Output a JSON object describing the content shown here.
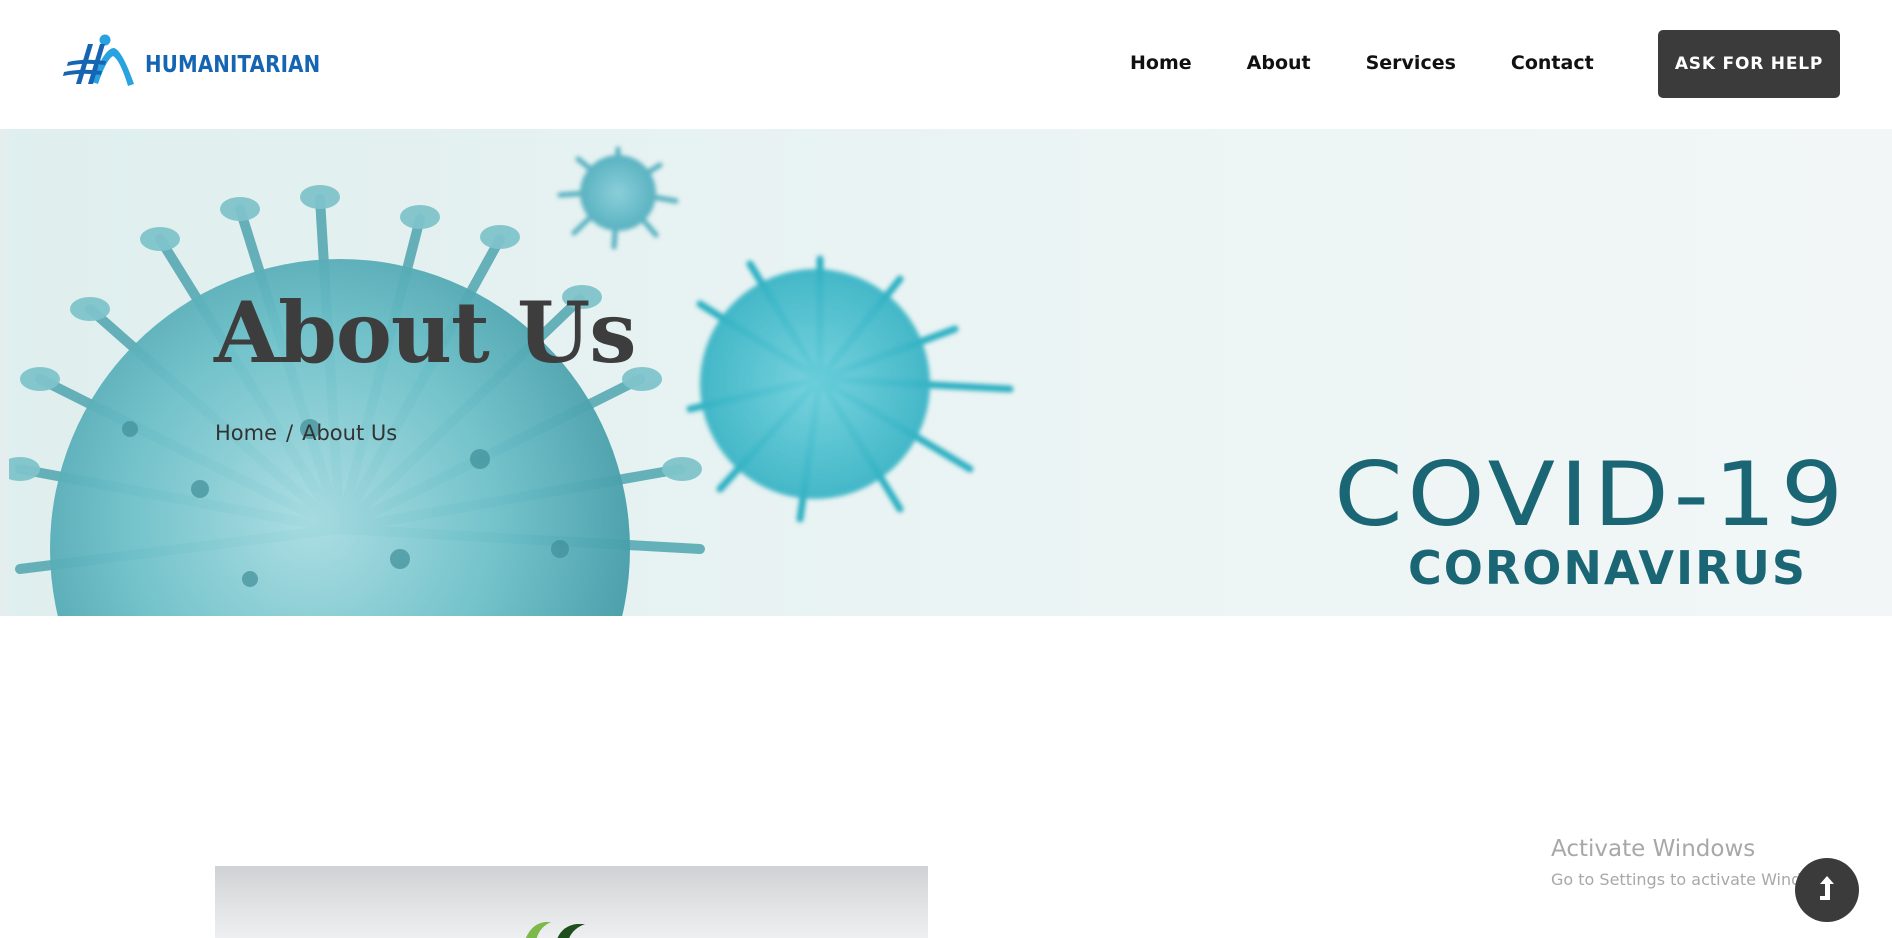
{
  "header": {
    "brand": "HUMANITARIAN",
    "nav": [
      {
        "label": "Home"
      },
      {
        "label": "About"
      },
      {
        "label": "Services"
      },
      {
        "label": "Contact"
      }
    ],
    "cta_label": "ASK FOR HELP"
  },
  "hero": {
    "title": "About Us",
    "breadcrumb": {
      "home": "Home",
      "separator": "/",
      "current": "About Us"
    },
    "banner_title": "COVID-19",
    "banner_subtitle": "CORONAVIRUS"
  },
  "watermark": {
    "title": "Activate Windows",
    "subtitle": "Go to Settings to activate Windows."
  },
  "icons": {
    "logo": "humanitarian-logo-icon",
    "back_to_top": "arrow-up-icon"
  },
  "colors": {
    "brand_blue": "#1565b3",
    "logo_light_blue": "#29a3e0",
    "cta_background": "#3b3b3b",
    "virus_teal": "#3aa9b5",
    "banner_text": "#1b6674"
  }
}
